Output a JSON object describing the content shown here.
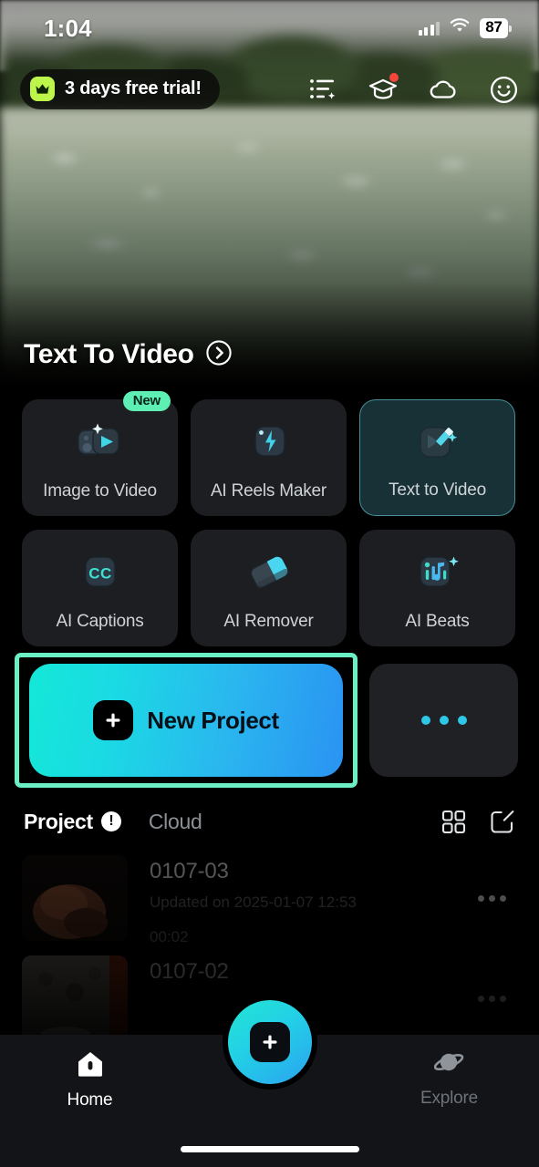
{
  "status_bar": {
    "time": "1:04",
    "battery_level": "87",
    "cellular_icon": "cellular-signal-icon",
    "wifi_icon": "wifi-icon",
    "battery_icon": "battery-icon"
  },
  "top_bar": {
    "trial_badge": {
      "label": "3 days free trial!",
      "icon": "crown-icon",
      "accent": "#bdf54a"
    },
    "icons": [
      {
        "name": "ai-tasks-icon",
        "badge": false
      },
      {
        "name": "graduation-cap-icon",
        "badge": true
      },
      {
        "name": "cloud-icon",
        "badge": false
      },
      {
        "name": "smiley-face-icon",
        "badge": false
      }
    ]
  },
  "section": {
    "title": "Text To Video",
    "arrow_icon": "chevron-right-circle-icon"
  },
  "features": [
    {
      "label": "Image to Video",
      "icon": "image-to-video-icon",
      "badge": "New",
      "selected": false
    },
    {
      "label": "AI Reels Maker",
      "icon": "lightning-bolt-icon",
      "badge": "",
      "selected": false
    },
    {
      "label": "Text  to Video",
      "icon": "pencil-video-icon",
      "badge": "",
      "selected": true
    },
    {
      "label": "AI Captions",
      "icon": "closed-caption-icon",
      "badge": "",
      "selected": false
    },
    {
      "label": "AI Remover",
      "icon": "eraser-icon",
      "badge": "",
      "selected": false
    },
    {
      "label": "AI Beats",
      "icon": "music-note-icon",
      "badge": "",
      "selected": false
    }
  ],
  "new_project": {
    "label": "New Project",
    "icon": "plus-square-icon",
    "highlight_color": "#6bf0c6",
    "gradient_start": "#14e8d8",
    "gradient_end": "#2a93f2"
  },
  "more_card": {
    "icon": "ellipsis-icon"
  },
  "list_header": {
    "tab_project": "Project",
    "warning_icon": "exclamation-icon",
    "tab_cloud": "Cloud",
    "grid_icon": "grid-view-icon",
    "edit_icon": "edit-compose-icon"
  },
  "projects": [
    {
      "name": "0107-03",
      "updated": "Updated on 2025-01-07 12:53",
      "duration": "00:02",
      "more_icon": "ellipsis-icon"
    },
    {
      "name": "0107-02",
      "updated": "",
      "duration": "",
      "more_icon": "ellipsis-icon"
    }
  ],
  "bottom_nav": {
    "home": {
      "label": "Home",
      "icon": "home-icon"
    },
    "create": {
      "icon": "plus-icon"
    },
    "explore": {
      "label": "Explore",
      "icon": "planet-icon"
    }
  }
}
